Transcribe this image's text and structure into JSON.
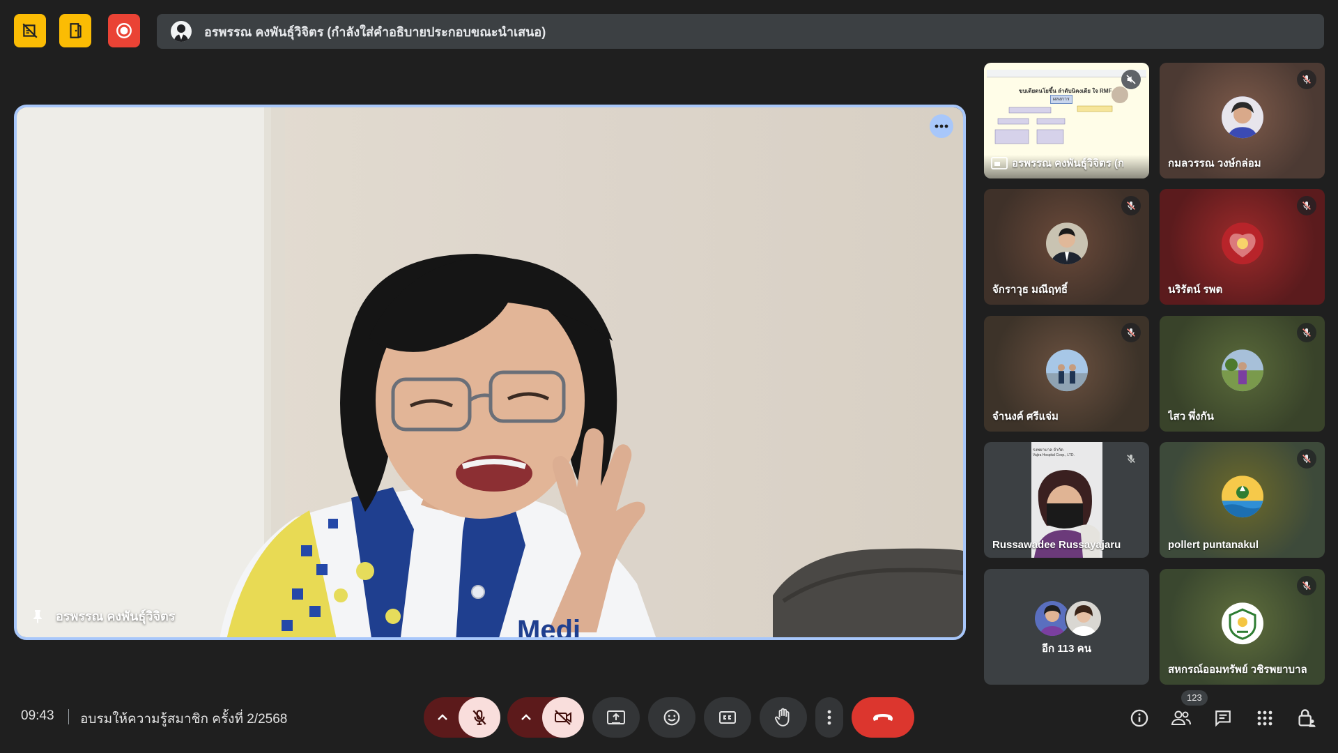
{
  "top_bar": {
    "icons": [
      "mute-all-icon",
      "door-icon",
      "record-icon"
    ],
    "banner": "อรพรรณ คงพันธุ์วิจิตร (กำลังใส่คำอธิบายประกอบขณะนำเสนอ)"
  },
  "main": {
    "presenter_name": "อรพรรณ คงพันธุ์วิจิตร",
    "shirt_text": "Medi"
  },
  "tiles": [
    {
      "id": "presentation",
      "name": "อรพรรณ คงพันธุ์วิจิตร (ก",
      "slide_title": "ขบเดียดนโยขึ้น ลำดับนิคงเดีย ใจ RMF",
      "slide_subtitle": "ผลงการ"
    },
    {
      "id": "kamonwan",
      "name": "กมลวรรณ วงษ์กล่อม"
    },
    {
      "id": "jakkrawut",
      "name": "จักราวุธ มณีฤทธิ์"
    },
    {
      "id": "narirat",
      "name": "นริรัตน์ รพต"
    },
    {
      "id": "chamnong",
      "name": "จำนงค์ ศรีแจ่ม"
    },
    {
      "id": "saow",
      "name": "ไสว พึ่งกัน"
    },
    {
      "id": "russawadee",
      "name": "Russawadee Russayajaru",
      "bg_text_1": "รงพยาบาล จำกัด",
      "bg_text_2": "Vajira Hospital Coop., LTD."
    },
    {
      "id": "pollert",
      "name": "pollert puntanakul"
    },
    {
      "id": "more",
      "label": "อีก 113 คน"
    },
    {
      "id": "coop",
      "name": "สหกรณ์ออมทรัพย์ วชิรพยาบาล"
    }
  ],
  "bottom": {
    "time": "09:43",
    "meeting_title": "อบรมให้ความรู้สมาชิก ครั้งที่ 2/2568",
    "participant_count": "123"
  },
  "colors": {
    "accent": "#a8c7fa",
    "end_call": "#dc362e",
    "muted_pink": "#f9dedc",
    "yellow": "#fbbc04",
    "record_red": "#ea4335"
  }
}
